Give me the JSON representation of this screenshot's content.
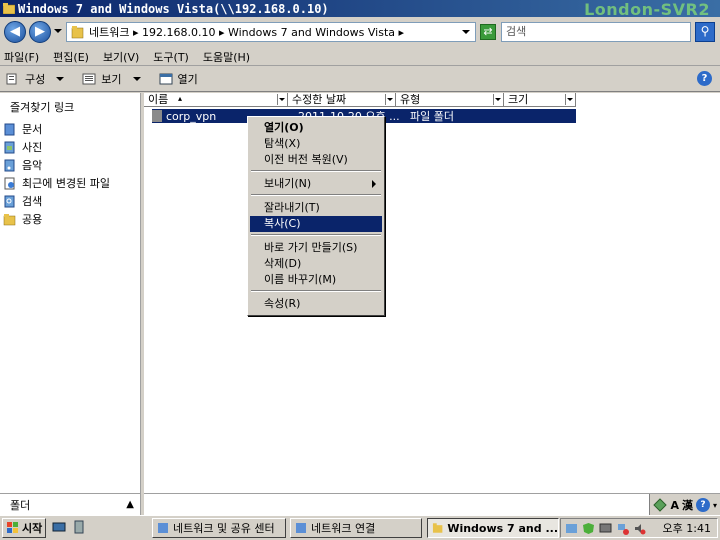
{
  "window": {
    "title": "Windows 7 and Windows Vista(\\\\192.168.0.10)",
    "watermark": "London-SVR2"
  },
  "address": {
    "path": "네트워크 ▸ 192.168.0.10 ▸ Windows 7 and Windows Vista ▸",
    "search_placeholder": "검색"
  },
  "menubar": {
    "items": [
      "파일(F)",
      "편집(E)",
      "보기(V)",
      "도구(T)",
      "도움말(H)"
    ]
  },
  "commandbar": {
    "organize": "구성",
    "views": "보기",
    "open": "열기"
  },
  "navpane": {
    "heading": "즐겨찾기 링크",
    "items": [
      "문서",
      "사진",
      "음악",
      "최근에 변경된 파일",
      "검색",
      "공용"
    ],
    "folders_label": "폴더"
  },
  "filelist": {
    "columns": [
      "이름",
      "수정한 날짜",
      "유형",
      "크기"
    ],
    "rows": [
      {
        "name": "corp_vpn",
        "modified": "2011-10-20 오후 ...",
        "type": "파일 폴더"
      }
    ]
  },
  "context_menu": {
    "items": [
      "열기(O)",
      "탐색(X)",
      "이전 버전 복원(V)",
      "보내기(N)",
      "잘라내기(T)",
      "복사(C)",
      "바로 가기 만들기(S)",
      "삭제(D)",
      "이름 바꾸기(M)",
      "속성(R)"
    ],
    "highlighted": "복사(C)"
  },
  "ime": {
    "mode1": "A",
    "mode2": "漢"
  },
  "taskbar": {
    "start": "시작",
    "tasks": [
      "네트워크 및 공유 센터",
      "네트워크 연결",
      "Windows 7 and ..."
    ],
    "clock": "오후 1:41"
  },
  "colors": {
    "titlebar": "#0a246a",
    "selection": "#0a246a",
    "chrome": "#d4d0c8"
  }
}
